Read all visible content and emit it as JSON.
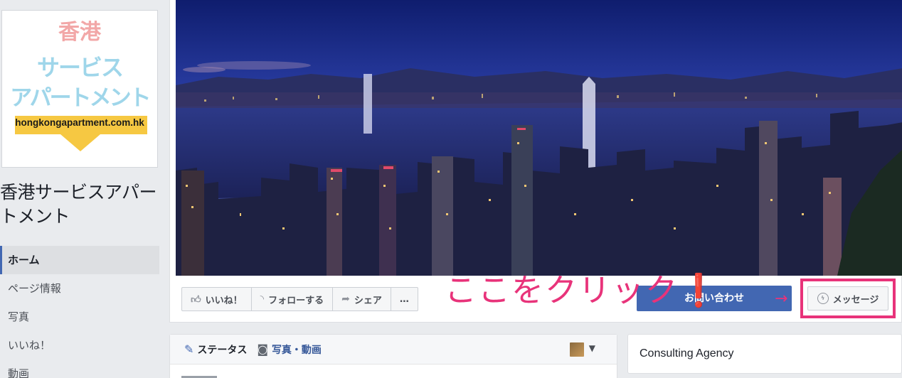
{
  "logo": {
    "line1": "香港",
    "line2": "サービス",
    "line3": "アパートメント",
    "url": "hongkongapartment.com.hk"
  },
  "page_name": "香港サービスアパートメント",
  "nav": [
    {
      "label": "ホーム",
      "active": true
    },
    {
      "label": "ページ情報"
    },
    {
      "label": "写真"
    },
    {
      "label": "いいね！"
    },
    {
      "label": "動画"
    }
  ],
  "actions": {
    "like": "いいね！",
    "follow": "フォローする",
    "share": "シェア",
    "more": "…"
  },
  "contact_button": "お問い合わせ",
  "message_button": "メッセージ",
  "annotation": "ここをクリック❗",
  "annotation_arrow": "→",
  "composer": {
    "status": "ステータス",
    "photo_video": "写真・動画"
  },
  "category": "Consulting Agency",
  "colors": {
    "accent": "#4267b2",
    "highlight": "#e8337a",
    "background": "#e9ebee"
  }
}
